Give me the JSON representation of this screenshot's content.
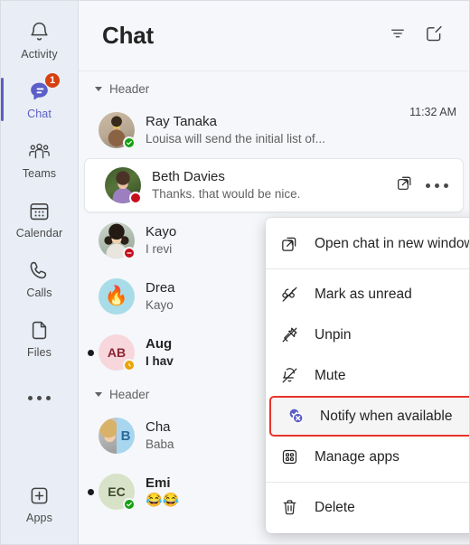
{
  "rail": {
    "items": [
      {
        "label": "Activity",
        "icon": "bell-icon",
        "active": false,
        "badge": ""
      },
      {
        "label": "Chat",
        "icon": "chat-bubble-icon",
        "active": true,
        "badge": "1"
      },
      {
        "label": "Teams",
        "icon": "people-icon",
        "active": false,
        "badge": ""
      },
      {
        "label": "Calendar",
        "icon": "calendar-icon",
        "active": false,
        "badge": ""
      },
      {
        "label": "Calls",
        "icon": "phone-icon",
        "active": false,
        "badge": ""
      },
      {
        "label": "Files",
        "icon": "file-icon",
        "active": false,
        "badge": ""
      }
    ],
    "more_label": "more-options-icon",
    "apps": {
      "label": "Apps",
      "icon": "apps-plus-icon"
    }
  },
  "header": {
    "title": "Chat",
    "filter_label": "filter-icon",
    "compose_label": "compose-icon"
  },
  "list": {
    "group_one_label": "Header",
    "group_two_label": "Header",
    "rows": [
      {
        "name": "Ray Tanaka",
        "message": "Louisa will send the initial list of...",
        "time": "11:32 AM",
        "presence": "available",
        "avatar_type": "photo-ray",
        "unread": false,
        "selected": false
      },
      {
        "name": "Beth Davies",
        "message": "Thanks. that would be nice.",
        "time": "",
        "presence": "busy",
        "avatar_type": "photo-beth",
        "unread": false,
        "selected": true
      },
      {
        "name": "Kayo",
        "message": "I revi",
        "time": "",
        "presence": "busy",
        "avatar_type": "photo-kayo",
        "unread": false,
        "selected": false
      },
      {
        "name": "Drea",
        "message": "Kayo",
        "time": "",
        "presence": "none",
        "avatar_type": "emoji-fire",
        "unread": false,
        "selected": false
      },
      {
        "name": "Aug",
        "message": "I hav",
        "time": "",
        "presence": "away",
        "avatar_type": "initials-ab",
        "initials": "AB",
        "unread": true,
        "selected": false
      },
      {
        "name": "Cha",
        "message": "Baba",
        "time": "",
        "presence": "none",
        "avatar_type": "split-b",
        "initials": "B",
        "unread": false,
        "selected": false
      },
      {
        "name": "Emi",
        "message": "😂😂",
        "time": "",
        "presence": "available",
        "avatar_type": "initials-ec",
        "initials": "EC",
        "unread": true,
        "selected": false
      }
    ],
    "selected_row_actions": {
      "popout_label": "open-in-new-window-icon",
      "more_label": "more-options-icon"
    }
  },
  "context_menu": {
    "items": [
      {
        "label": "Open chat in new window",
        "icon": "open-in-new-window-icon",
        "highlighted": false
      },
      {
        "label": "Mark as unread",
        "icon": "mark-unread-icon",
        "highlighted": false
      },
      {
        "label": "Unpin",
        "icon": "unpin-icon",
        "highlighted": false
      },
      {
        "label": "Mute",
        "icon": "mute-bell-icon",
        "highlighted": false
      },
      {
        "label": "Notify when available",
        "icon": "notify-when-available-icon",
        "highlighted": true
      },
      {
        "label": "Manage apps",
        "icon": "manage-apps-icon",
        "highlighted": false
      },
      {
        "label": "Delete",
        "icon": "delete-trash-icon",
        "highlighted": false
      }
    ]
  },
  "colors": {
    "accent_purple": "#5b5fc7",
    "badge_red": "#d74011",
    "available_green": "#13a10e",
    "busy_red": "#c50f1f",
    "away_yellow": "#eaa300",
    "highlight_outline": "#e8342a",
    "rail_bg": "#e9eef6",
    "list_bg": "#f5f7fa"
  }
}
